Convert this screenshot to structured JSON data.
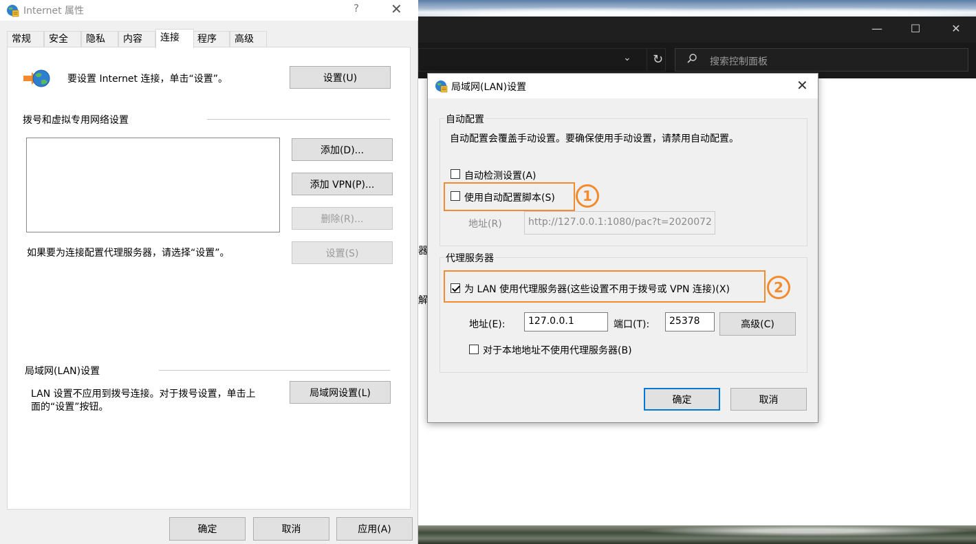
{
  "desktop": {
    "control_panel": {
      "search_placeholder": "搜索控制面板",
      "fragment_1": "器",
      "fragment_2": "解"
    }
  },
  "internet_properties": {
    "title": "Internet 属性",
    "help": "?",
    "close": "✕",
    "tabs": [
      {
        "label": "常规"
      },
      {
        "label": "安全"
      },
      {
        "label": "隐私"
      },
      {
        "label": "内容"
      },
      {
        "label": "连接",
        "active": true
      },
      {
        "label": "程序"
      },
      {
        "label": "高级"
      }
    ],
    "connections": {
      "setup_text": "要设置 Internet 连接，单击“设置”。",
      "setup_button": "设置(U)",
      "dialup_group": "拨号和虚拟专用网络设置",
      "add_button": "添加(D)...",
      "add_vpn_button": "添加 VPN(P)...",
      "remove_button": "删除(R)...",
      "proxy_hint": "如果要为连接配置代理服务器，请选择“设置”。",
      "settings_button": "设置(S)",
      "lan_group": "局域网(LAN)设置",
      "lan_text_line1": "LAN 设置不应用到拨号连接。对于拨号设置，单击上",
      "lan_text_line2": "面的“设置”按钮。",
      "lan_settings_button": "局域网设置(L)"
    },
    "footer": {
      "ok": "确定",
      "cancel": "取消",
      "apply": "应用(A)"
    }
  },
  "lan_dialog": {
    "title": "局域网(LAN)设置",
    "close": "✕",
    "auto_config": {
      "group_label": "自动配置",
      "description": "自动配置会覆盖手动设置。要确保使用手动设置，请禁用自动配置。",
      "auto_detect_label": "自动检测设置(A)",
      "auto_detect_checked": false,
      "use_script_label": "使用自动配置脚本(S)",
      "use_script_checked": false,
      "address_label": "地址(R)",
      "address_value": "http://127.0.0.1:1080/pac?t=2020072"
    },
    "proxy": {
      "group_label": "代理服务器",
      "use_proxy_label": "为 LAN 使用代理服务器(这些设置不用于拨号或 VPN 连接)(X)",
      "use_proxy_checked": true,
      "address_label": "地址(E):",
      "address_value": "127.0.0.1",
      "port_label": "端口(T):",
      "port_value": "25378",
      "advanced_button": "高级(C)",
      "bypass_label": "对于本地地址不使用代理服务器(B)",
      "bypass_checked": false
    },
    "ok": "确定",
    "cancel": "取消"
  },
  "annotations": {
    "callout_1": "1",
    "callout_2": "2",
    "highlight_color": "#f28a2e"
  }
}
